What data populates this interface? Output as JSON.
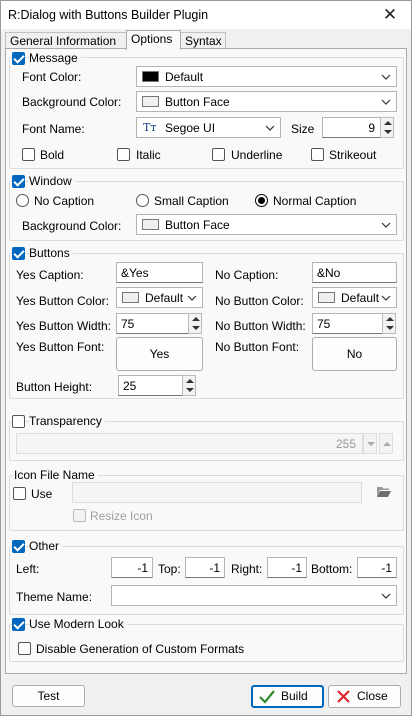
{
  "window": {
    "title": "R:Dialog with Buttons Builder Plugin",
    "close_glyph": "✕"
  },
  "tabs": [
    {
      "label": "General Information"
    },
    {
      "label": "Options"
    },
    {
      "label": "Syntax"
    }
  ],
  "message": {
    "label": "Message",
    "checked": true,
    "font_color_label": "Font Color:",
    "font_color_value": "Default",
    "font_color_swatch": "#000000",
    "bg_color_label": "Background Color:",
    "bg_color_value": "Button Face",
    "bg_color_swatch": "#f0f0f0",
    "font_name_label": "Font Name:",
    "font_name_value": "Segoe UI",
    "font_icon": "Tт",
    "size_label": "Size",
    "size_value": "9",
    "bold": "Bold",
    "italic": "Italic",
    "underline": "Underline",
    "strikeout": "Strikeout"
  },
  "window_group": {
    "label": "Window",
    "checked": true,
    "no_caption": "No Caption",
    "small_caption": "Small Caption",
    "normal_caption": "Normal Caption",
    "selected": "normal_caption",
    "bg_color_label": "Background Color:",
    "bg_color_value": "Button Face",
    "bg_color_swatch": "#f0f0f0"
  },
  "buttons": {
    "label": "Buttons",
    "checked": true,
    "yes_caption_label": "Yes Caption:",
    "yes_caption_value": "&Yes",
    "no_caption_label": "No Caption:",
    "no_caption_value": "&No",
    "yes_color_label": "Yes Button Color:",
    "yes_color_value": "Default",
    "no_color_label": "No Button Color:",
    "no_color_value": "Default",
    "yes_width_label": "Yes Button Width:",
    "yes_width_value": "75",
    "no_width_label": "No Button Width:",
    "no_width_value": "75",
    "yes_font_label": "Yes Button  Font:",
    "yes_font_button": "Yes",
    "no_font_label": "No Button  Font:",
    "no_font_button": "No",
    "height_label": "Button Height:",
    "height_value": "25"
  },
  "transparency": {
    "label": "Transparency",
    "checked": false,
    "value": "255"
  },
  "icon_file": {
    "group_label": "Icon File Name",
    "use_label": "Use",
    "use_checked": false,
    "path_value": "",
    "resize_label": "Resize Icon",
    "resize_checked": false,
    "folder_icon": "folder-open-icon"
  },
  "other": {
    "label": "Other",
    "checked": true,
    "left_label": "Left:",
    "left_value": "-1",
    "top_label": "Top:",
    "top_value": "-1",
    "right_label": "Right:",
    "right_value": "-1",
    "bottom_label": "Bottom:",
    "bottom_value": "-1",
    "theme_label": "Theme Name:",
    "theme_value": ""
  },
  "modern": {
    "label": "Use Modern Look",
    "checked": true,
    "disable_label": "Disable Generation of Custom Formats",
    "disable_checked": false
  },
  "footer": {
    "test_label": "Test",
    "build_label": "Build",
    "close_label": "Close"
  },
  "colors": {
    "accent": "#0067c0",
    "build_check": "#2e8b2e",
    "close_x": "#d9262c"
  }
}
